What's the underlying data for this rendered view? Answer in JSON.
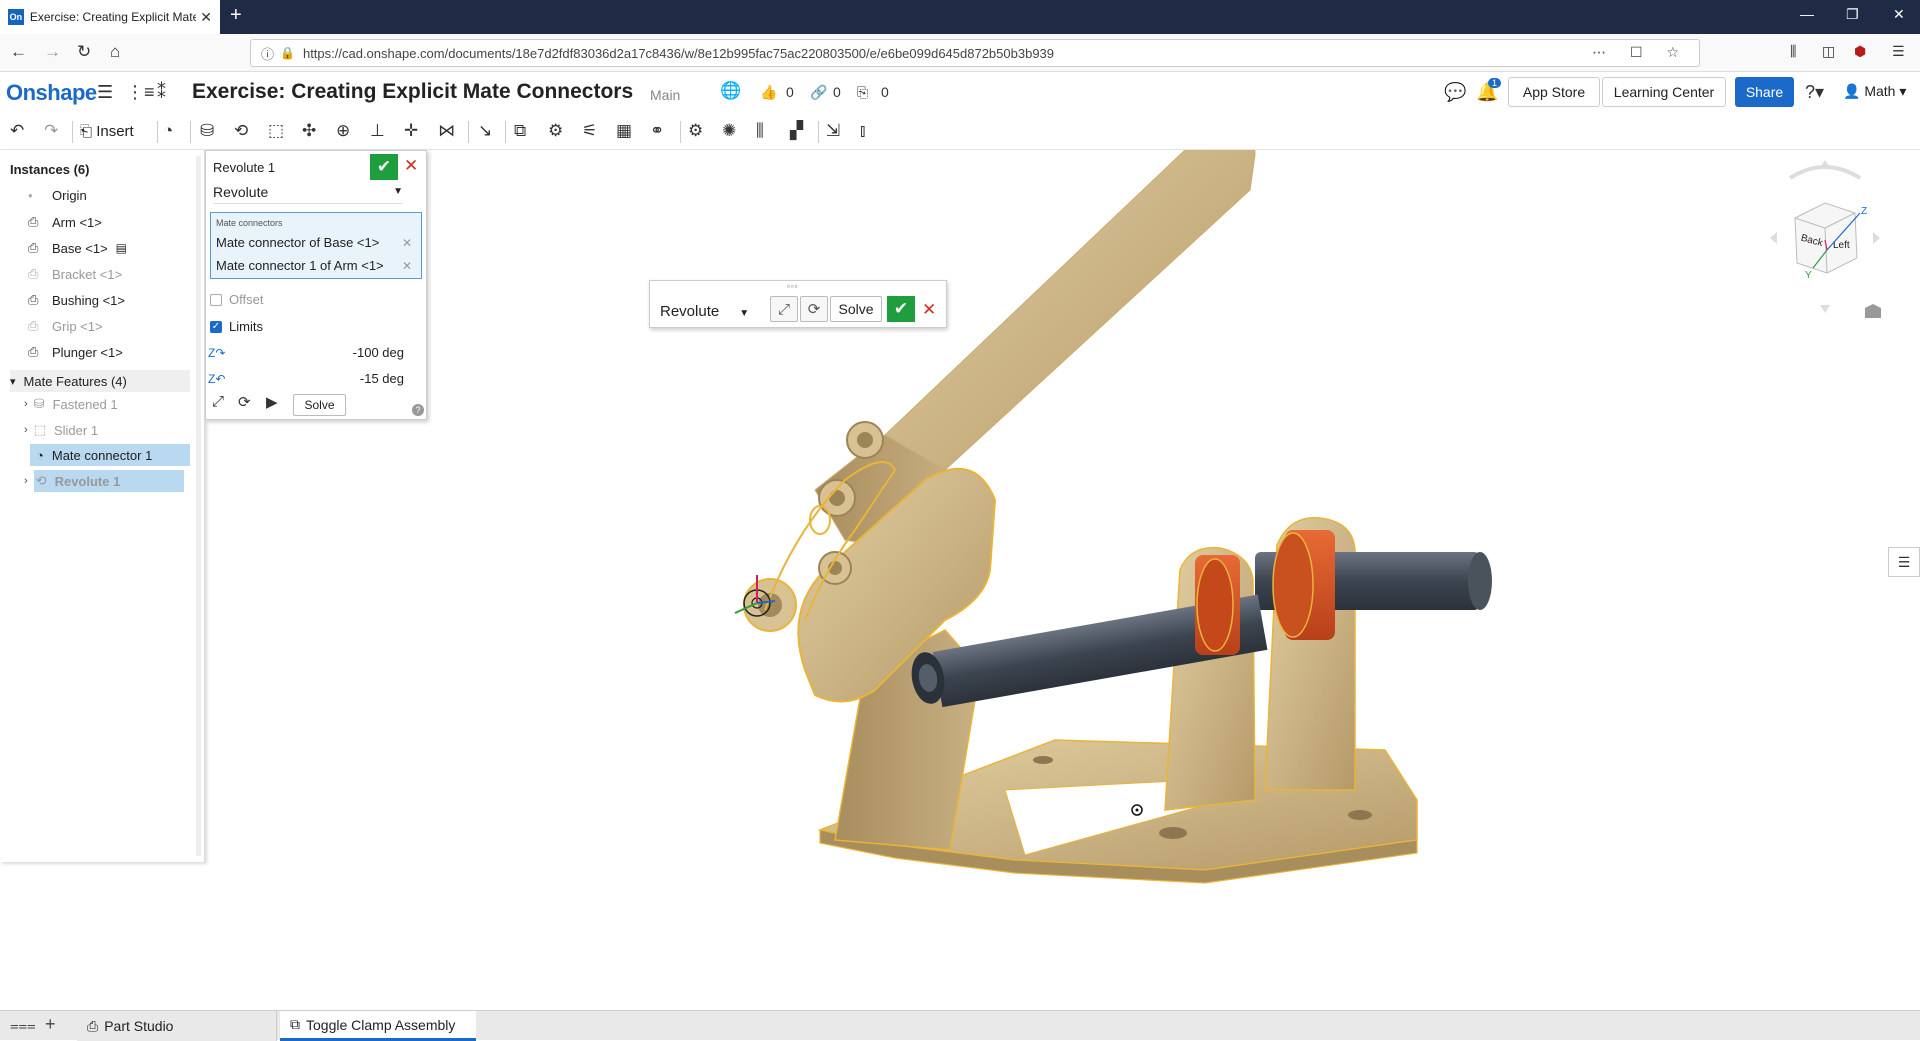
{
  "browser": {
    "tab_title": "Exercise: Creating Explicit Mate",
    "tab_favicon": "On",
    "new_tab": "+",
    "url": "https://cad.onshape.com/documents/18e7d2fdf83036d2a17c8436/w/8e12b995fac75ac220803500/e/e6be099d645d872b50b3b939"
  },
  "app": {
    "logo": "Onshape",
    "document_title": "Exercise: Creating Explicit Mate Connectors",
    "workspace": "Main",
    "likes": "0",
    "links": "0",
    "copies": "0",
    "notifications": "1",
    "app_store": "App Store",
    "learning_center": "Learning Center",
    "share": "Share",
    "user": "Math",
    "brand_color": "#1b6ac9"
  },
  "toolbar": {
    "insert": "Insert"
  },
  "instances": {
    "header": "Instances (6)",
    "items": [
      {
        "label": "Origin",
        "icon": "origin-icon",
        "dim": false
      },
      {
        "label": "Arm <1>",
        "icon": "part-icon",
        "dim": false
      },
      {
        "label": "Base <1>",
        "icon": "part-icon",
        "dim": false
      },
      {
        "label": "Bracket <1>",
        "icon": "part-icon",
        "dim": true
      },
      {
        "label": "Bushing <1>",
        "icon": "part-icon",
        "dim": false
      },
      {
        "label": "Grip <1>",
        "icon": "part-icon",
        "dim": true
      },
      {
        "label": "Plunger <1>",
        "icon": "part-icon",
        "dim": false
      }
    ],
    "mate_features_header": "Mate Features (4)",
    "mate_features": [
      {
        "label": "Fastened 1"
      },
      {
        "label": "Slider 1"
      },
      {
        "label": "Mate connector 1"
      },
      {
        "label": "Revolute 1"
      }
    ]
  },
  "dialog": {
    "title": "Revolute 1",
    "type": "Revolute",
    "mate_connectors_label": "Mate connectors",
    "connector_1": "Mate connector of Base <1>",
    "connector_2": "Mate connector 1 of Arm <1>",
    "offset": "Offset",
    "limits": "Limits",
    "limits_checked": true,
    "offset_checked": false,
    "limit_min": "-100 deg",
    "limit_max": "-15 deg",
    "solve": "Solve",
    "help": "?"
  },
  "mate_dialog": {
    "type": "Revolute",
    "solve": "Solve"
  },
  "viewcube": {
    "back": "Back",
    "left": "Left",
    "z": "Z",
    "y": "Y"
  },
  "bottom_tabs": {
    "part_studio": "Part Studio",
    "assembly": "Toggle Clamp Assembly"
  }
}
